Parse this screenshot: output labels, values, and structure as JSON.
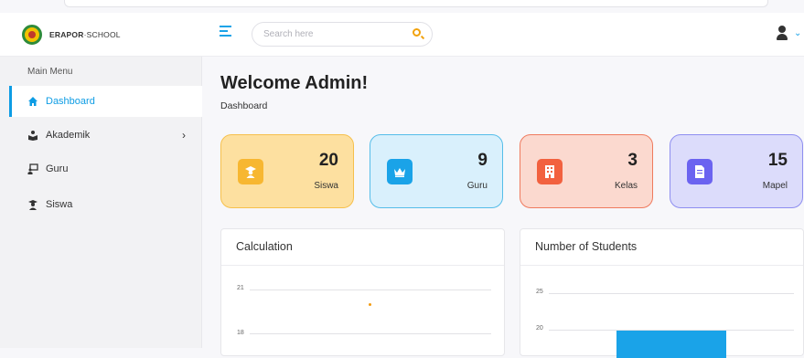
{
  "brand": {
    "name_bold": "ERAPOR",
    "name_rest": "·SCHOOL"
  },
  "sidebar": {
    "menu_title": "Main Menu",
    "items": [
      {
        "label": "Dashboard",
        "icon": "home-icon",
        "active": true
      },
      {
        "label": "Akademik",
        "icon": "reading-icon",
        "has_children": true
      },
      {
        "label": "Guru",
        "icon": "chalkboard-icon"
      },
      {
        "label": "Siswa",
        "icon": "student-icon"
      }
    ]
  },
  "header": {
    "search_placeholder": "Search here",
    "chevron": "⌄",
    "submenu_chevron": "›"
  },
  "page": {
    "title": "Welcome Admin!",
    "breadcrumb": "Dashboard"
  },
  "stats": [
    {
      "value": "20",
      "label": "Siswa",
      "icon": "graduate-icon",
      "bg": "#fde0a0",
      "border": "#f6c04c",
      "icon_bg": "#f7b731"
    },
    {
      "value": "9",
      "label": "Guru",
      "icon": "crown-icon",
      "bg": "#d9f0fc",
      "border": "#55bde9",
      "icon_bg": "#1aa3e8"
    },
    {
      "value": "3",
      "label": "Kelas",
      "icon": "building-icon",
      "bg": "#fbd9cf",
      "border": "#ef7a5e",
      "icon_bg": "#f2613f"
    },
    {
      "value": "15",
      "label": "Mapel",
      "icon": "document-icon",
      "bg": "#dcdcfb",
      "border": "#8e8ef0",
      "icon_bg": "#6b63f0"
    }
  ],
  "cards": {
    "calculation": {
      "title": "Calculation",
      "y_ticks": [
        "21",
        "18"
      ]
    },
    "students": {
      "title": "Number of Students",
      "y_ticks": [
        "25",
        "20"
      ]
    }
  },
  "colors": {
    "accent": "#1aa3e8",
    "search_icon": "#f2a20c",
    "point": "#f39c12"
  }
}
